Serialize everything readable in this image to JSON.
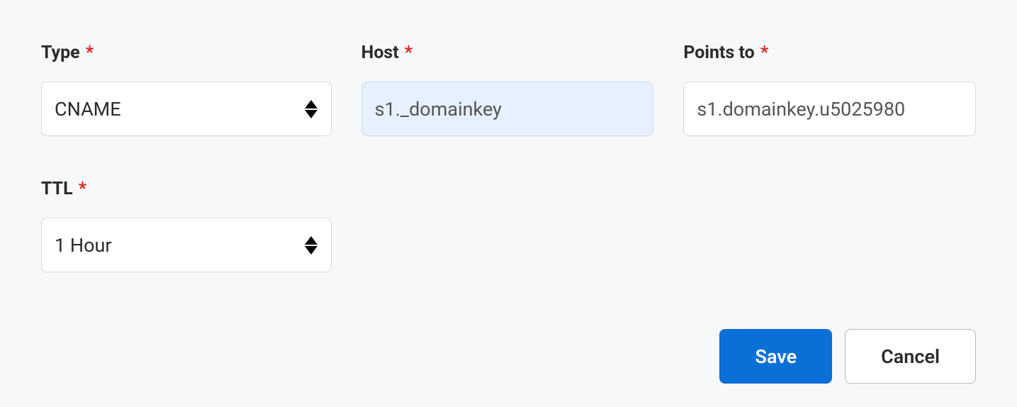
{
  "form": {
    "type": {
      "label": "Type",
      "required": "*",
      "value": "CNAME"
    },
    "host": {
      "label": "Host",
      "required": "*",
      "value": "s1._domainkey"
    },
    "points_to": {
      "label": "Points to",
      "required": "*",
      "value": "s1.domainkey.u5025980"
    },
    "ttl": {
      "label": "TTL",
      "required": "*",
      "value": "1 Hour"
    }
  },
  "buttons": {
    "save": "Save",
    "cancel": "Cancel"
  }
}
